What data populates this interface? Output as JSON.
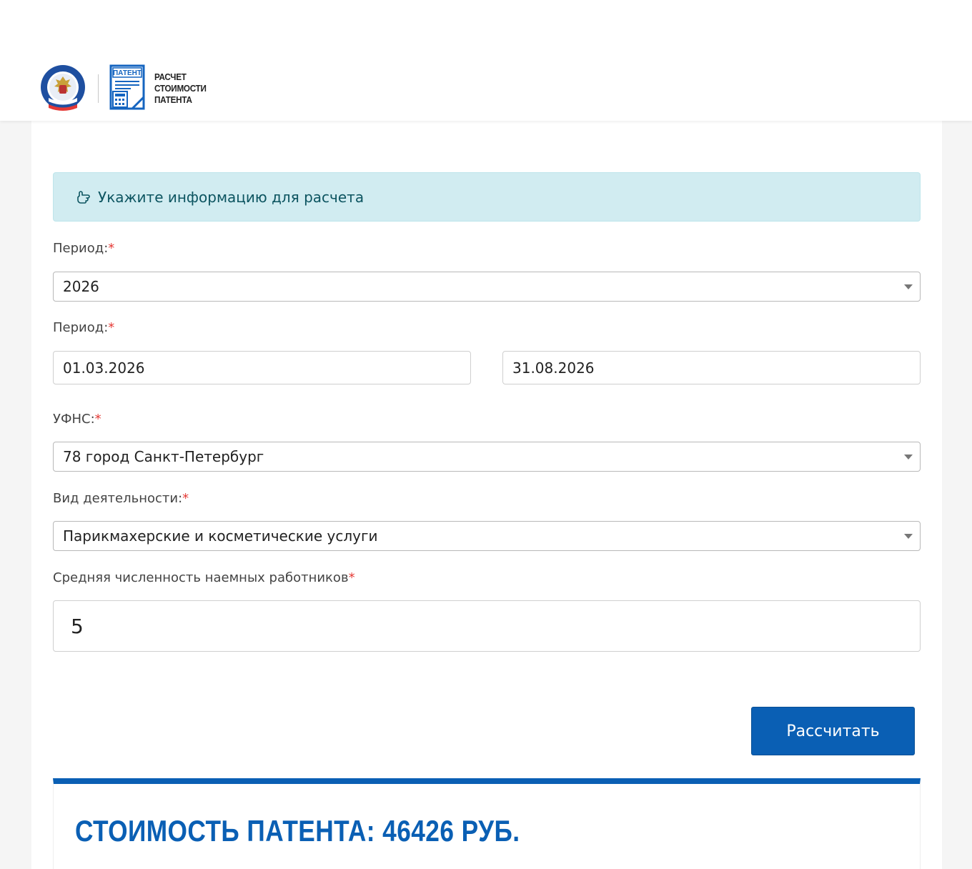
{
  "header": {
    "logo_lines": [
      "РАСЧЕТ",
      "СТОИМОСТИ",
      "ПАТЕНТА"
    ],
    "patent_icon_text": "ПАТЕНТ",
    "emblem_icon": "fns-emblem-icon"
  },
  "alert": {
    "icon": "hand-pointing-icon",
    "text": "Укажите информацию для расчета"
  },
  "form": {
    "year_label": "Период:",
    "year_value": "2026",
    "period_label": "Период:",
    "date_from": "01.03.2026",
    "date_to": "31.08.2026",
    "ufns_label": "УФНС:",
    "ufns_value": "78 город Санкт-Петербург",
    "activity_label": "Вид деятельности:",
    "activity_value": "Парикмахерские и косметические услуги",
    "employees_label": "Средняя численность наемных работников",
    "employees_value": "5",
    "required_mark": "*"
  },
  "actions": {
    "calculate_label": "Рассчитать"
  },
  "result": {
    "title": "СТОИМОСТЬ ПАТЕНТА: 46426 РУБ."
  },
  "colors": {
    "accent": "#0a5fb4",
    "alert_bg": "#d1ecf1",
    "required": "#e53935"
  }
}
